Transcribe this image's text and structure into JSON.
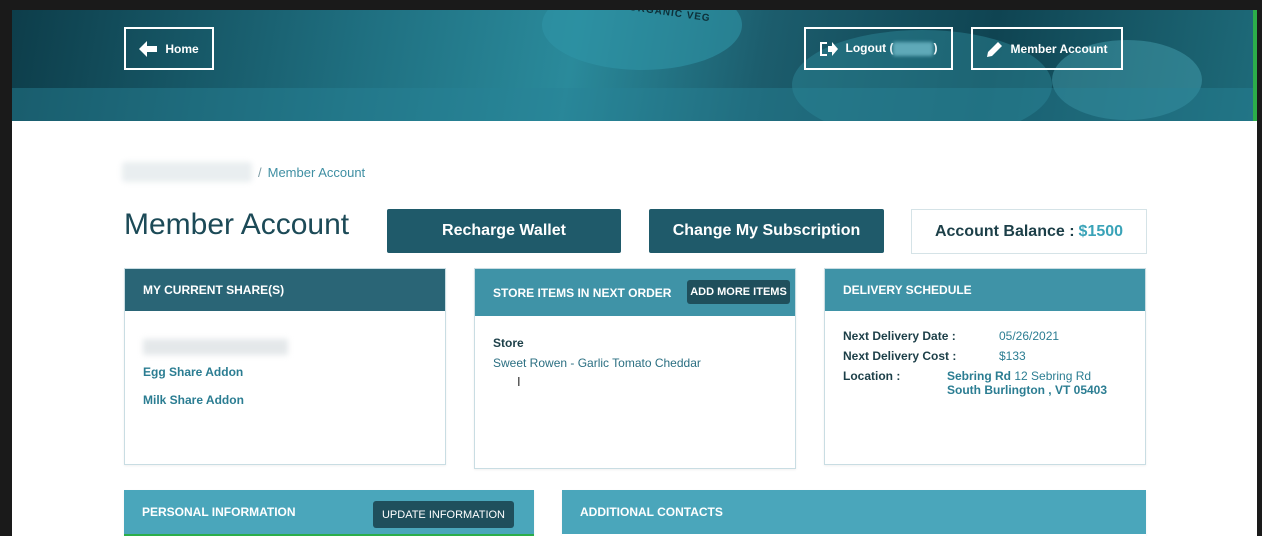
{
  "header": {
    "home_label": "Home",
    "logout_label": "Logout (",
    "logout_suffix": ")",
    "member_account_label": "Member Account",
    "seal_text": "SEASON ORGANIC VEG"
  },
  "breadcrumb": {
    "separator": "/",
    "current": "Member Account"
  },
  "page": {
    "title": "Member Account",
    "recharge_label": "Recharge Wallet",
    "change_subscription_label": "Change My Subscription",
    "balance_label": "Account Balance :",
    "balance_value": "$1500"
  },
  "shares": {
    "heading": "MY CURRENT SHARE(S)",
    "items": [
      "Egg Share Addon",
      "Milk Share Addon"
    ]
  },
  "store": {
    "heading": "STORE ITEMS IN NEXT ORDER",
    "add_button": "ADD MORE ITEMS",
    "label": "Store",
    "item": "Sweet Rowen - Garlic Tomato Cheddar"
  },
  "delivery": {
    "heading": "DELIVERY SCHEDULE",
    "date_label": "Next Delivery Date :",
    "date_value": "05/26/2021",
    "cost_label": "Next Delivery Cost :",
    "cost_value": "$133",
    "location_label": "Location :",
    "location_name": "Sebring Rd",
    "location_street": "12 Sebring Rd",
    "location_city": "South Burlington , VT 05403"
  },
  "personal": {
    "heading": "PERSONAL INFORMATION",
    "update_button": "UPDATE INFORMATION"
  },
  "contacts": {
    "heading": "ADDITIONAL CONTACTS"
  },
  "colors": {
    "header_dark": "#2a6576",
    "accent": "#3aa3b8",
    "button": "#1f5a6a"
  }
}
